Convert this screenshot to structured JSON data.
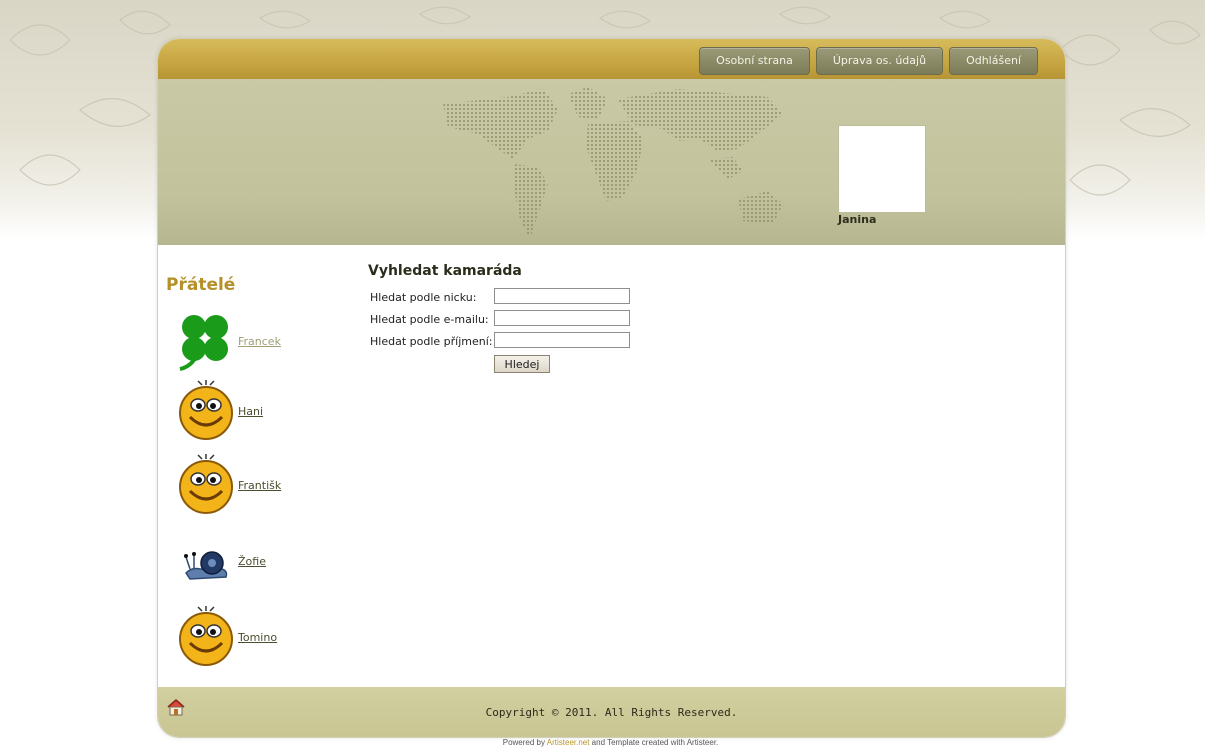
{
  "nav": {
    "items": [
      {
        "label": "Osobní strana"
      },
      {
        "label": "Úprava os. údajů"
      },
      {
        "label": "Odhlášení"
      }
    ]
  },
  "profile": {
    "name": "Janina",
    "avatar_icon": "dragon-tattoo-icon"
  },
  "sidebar": {
    "title": "Přátelé",
    "friends": [
      {
        "name": "Francek",
        "icon": "clover-icon",
        "visited": true
      },
      {
        "name": "Hani",
        "icon": "smiley-icon",
        "visited": false
      },
      {
        "name": "Františk",
        "icon": "smiley-icon",
        "visited": false
      },
      {
        "name": "Žofie",
        "icon": "snail-icon",
        "visited": false
      },
      {
        "name": "Tomino",
        "icon": "smiley-icon",
        "visited": false
      }
    ]
  },
  "search": {
    "title": "Vyhledat kamaráda",
    "fields": [
      {
        "label": "Hledat podle nicku:",
        "value": ""
      },
      {
        "label": "Hledat podle e-mailu:",
        "value": ""
      },
      {
        "label": "Hledat podle příjmení:",
        "value": ""
      }
    ],
    "button_label": "Hledej"
  },
  "footer": {
    "copyright": "Copyright © 2011. All Rights Reserved.",
    "home_icon": "home-icon",
    "powered_prefix": "Powered by ",
    "powered_link": "Artisteer.net",
    "powered_suffix": " and Template created with Artisteer."
  },
  "colors": {
    "accent": "#c9a845",
    "header": "#c2c29c",
    "nav_button": "#8a8a66",
    "footer": "#cdca98"
  }
}
